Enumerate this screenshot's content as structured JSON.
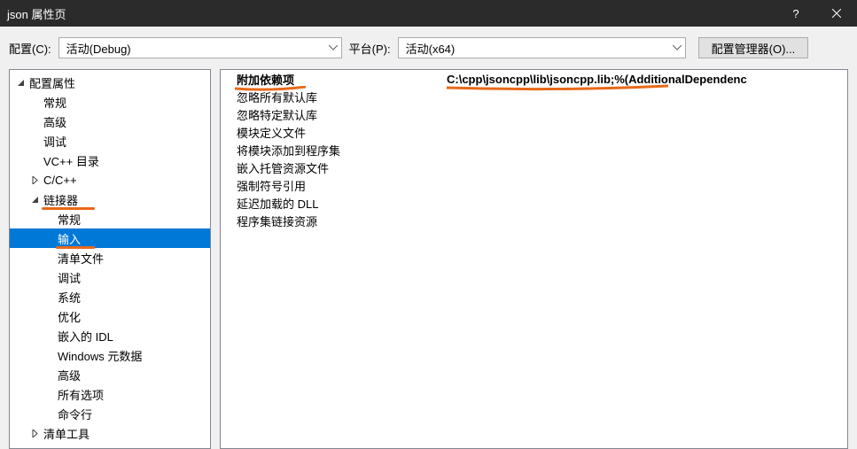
{
  "titlebar": {
    "title": "json 属性页",
    "help": "?",
    "close": "✕"
  },
  "toolbar": {
    "config_label": "配置(C):",
    "config_value": "活动(Debug)",
    "platform_label": "平台(P):",
    "platform_value": "活动(x64)",
    "config_mgr_label": "配置管理器(O)..."
  },
  "tree": {
    "root": "配置属性",
    "items_l1": {
      "general": "常规",
      "advanced": "高级",
      "debug": "调试",
      "vcdirs": "VC++ 目录",
      "cpp": "C/C++",
      "linker": "链接器",
      "manifest": "清单工具"
    },
    "linker_children": {
      "general": "常规",
      "input": "输入",
      "manifest_file": "清单文件",
      "debug": "调试",
      "system": "系统",
      "optimize": "优化",
      "embedded_idl": "嵌入的 IDL",
      "win_metadata": "Windows 元数据",
      "advanced": "高级",
      "all_options": "所有选项",
      "cmdline": "命令行"
    }
  },
  "props": {
    "rows": [
      {
        "name": "附加依赖项",
        "value": "C:\\cpp\\jsoncpp\\lib\\jsoncpp.lib;%(AdditionalDependenc",
        "bold": true
      },
      {
        "name": "忽略所有默认库",
        "value": ""
      },
      {
        "name": "忽略特定默认库",
        "value": ""
      },
      {
        "name": "模块定义文件",
        "value": ""
      },
      {
        "name": "将模块添加到程序集",
        "value": ""
      },
      {
        "name": "嵌入托管资源文件",
        "value": ""
      },
      {
        "name": "强制符号引用",
        "value": ""
      },
      {
        "name": "延迟加载的 DLL",
        "value": ""
      },
      {
        "name": "程序集链接资源",
        "value": ""
      }
    ]
  }
}
